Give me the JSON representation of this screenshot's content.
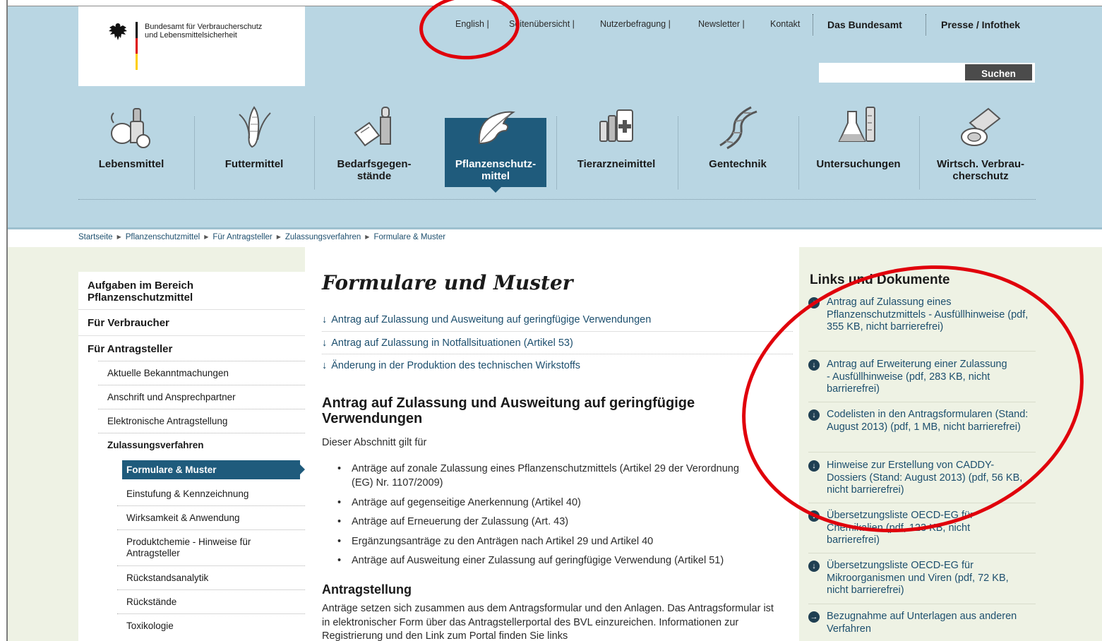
{
  "org": {
    "name": "Bundesamt für Verbraucherschutz und Lebensmittelsicherheit",
    "flag_colors": [
      "#000000",
      "#dd0000",
      "#ffce00"
    ]
  },
  "topnav": {
    "english": "English |",
    "sitemap": "Seitenübersicht |",
    "survey": "Nutzerbefragung |",
    "newsletter": "Newsletter |",
    "contact": "Kontakt",
    "office": "Das Bundesamt",
    "press": "Presse / Infothek"
  },
  "search": {
    "placeholder": "",
    "button": "Suchen"
  },
  "categories": [
    {
      "label": "Lebensmittel",
      "icon": "food-icon"
    },
    {
      "label": "Futtermittel",
      "icon": "corn-icon"
    },
    {
      "label": "Bedarfsgegen-\nstände",
      "icon": "cosmetics-icon"
    },
    {
      "label": "Pflanzenschutz-\nmittel",
      "icon": "plant-protection-icon"
    },
    {
      "label": "Tierarzneimittel",
      "icon": "veterinary-medicine-icon"
    },
    {
      "label": "Gentechnik",
      "icon": "dna-icon"
    },
    {
      "label": "Untersuchungen",
      "icon": "lab-flask-icon"
    },
    {
      "label": "Wirtsch. Verbrau-\ncherschutz",
      "icon": "plates-icon"
    }
  ],
  "breadcrumb": [
    "Startseite",
    "Pflanzenschutzmittel",
    "Für Antragsteller",
    "Zulassungsverfahren",
    "Formulare & Muster"
  ],
  "sidebar": {
    "top_items": [
      "Aufgaben im Bereich Pflanzenschutzmittel",
      "Für Verbraucher",
      "Für Antragsteller"
    ],
    "sub_items": [
      "Aktuelle Bekanntmachungen",
      "Anschrift und Ansprechpartner",
      "Elektronische Antragstellung",
      "Zulassungsverfahren"
    ],
    "active": "Formulare & Muster",
    "sub_sub_items": [
      "Einstufung & Kennzeichnung",
      "Wirksamkeit & Anwendung",
      "Produktchemie - Hinweise für Antragsteller",
      "Rückstandsanalytik",
      "Rückstände",
      "Toxikologie"
    ]
  },
  "main": {
    "title": "Formulare und Muster",
    "anchors": [
      "Antrag auf Zulassung und Ausweitung auf geringfügige Verwendungen",
      "Antrag auf Zulassung in Notfallsituationen (Artikel 53)",
      "Änderung in der Produktion des technischen Wirkstoffs"
    ],
    "section_heading": "Antrag auf Zulassung und Ausweitung auf geringfügige Verwendungen",
    "intro": "Dieser Abschnitt gilt für",
    "bullets": [
      "Anträge auf zonale Zulassung eines Pflanzenschutzmittels (Artikel 29 der Verordnung (EG) Nr. 1107/2009)",
      "Anträge auf gegenseitige Anerkennung (Artikel 40)",
      "Anträge auf Erneuerung der Zulassung (Art. 43)",
      "Ergänzungsanträge zu den Anträgen nach Artikel 29 und Artikel 40",
      "Anträge auf Ausweitung einer Zulassung auf geringfügige Verwendung (Artikel 51)"
    ],
    "subheading": "Antragstellung",
    "body": "Anträge setzen sich zusammen aus dem Antragsformular und den Anlagen. Das Antragsformular ist in elektronischer Form über das Antragstellerportal des BVL einzureichen. Informationen zur Registrierung und den Link zum Portal finden Sie links"
  },
  "links": {
    "title": "Links und Dokumente",
    "items": [
      {
        "text": "Antrag auf Zulassung eines Pflanzenschutzmittels - Ausfüllhinweise (pdf, 355 KB, nicht barrierefrei)",
        "icon": "download-icon"
      },
      {
        "text": "Antrag auf Erweiterung einer Zulassung - Ausfüllhinweise (pdf, 283 KB, nicht barrierefrei)",
        "icon": "download-icon"
      },
      {
        "text": "Codelisten in den Antragsformularen (Stand: August 2013) (pdf, 1 MB, nicht barrierefrei)",
        "icon": "download-icon"
      },
      {
        "text": "Hinweise zur Erstellung von CADDY-Dossiers (Stand: August 2013) (pdf, 56 KB, nicht barrierefrei)",
        "icon": "download-icon"
      },
      {
        "text": "Übersetzungsliste OECD-EG für Chemikalien (pdf, 123 KB, nicht barrierefrei)",
        "icon": "download-icon"
      },
      {
        "text": "Übersetzungsliste OECD-EG für Mikroorganismen und Viren (pdf, 72 KB, nicht barrierefrei)",
        "icon": "download-icon"
      },
      {
        "text": "Bezugnahme auf Unterlagen aus anderen Verfahren",
        "icon": "arrow-right-icon"
      }
    ]
  },
  "colors": {
    "header_bg": "#b9d6e3",
    "accent": "#1f5b7c",
    "link": "#1d4f6e",
    "content_bg": "#eef2e4",
    "annotation": "#e0000b"
  }
}
